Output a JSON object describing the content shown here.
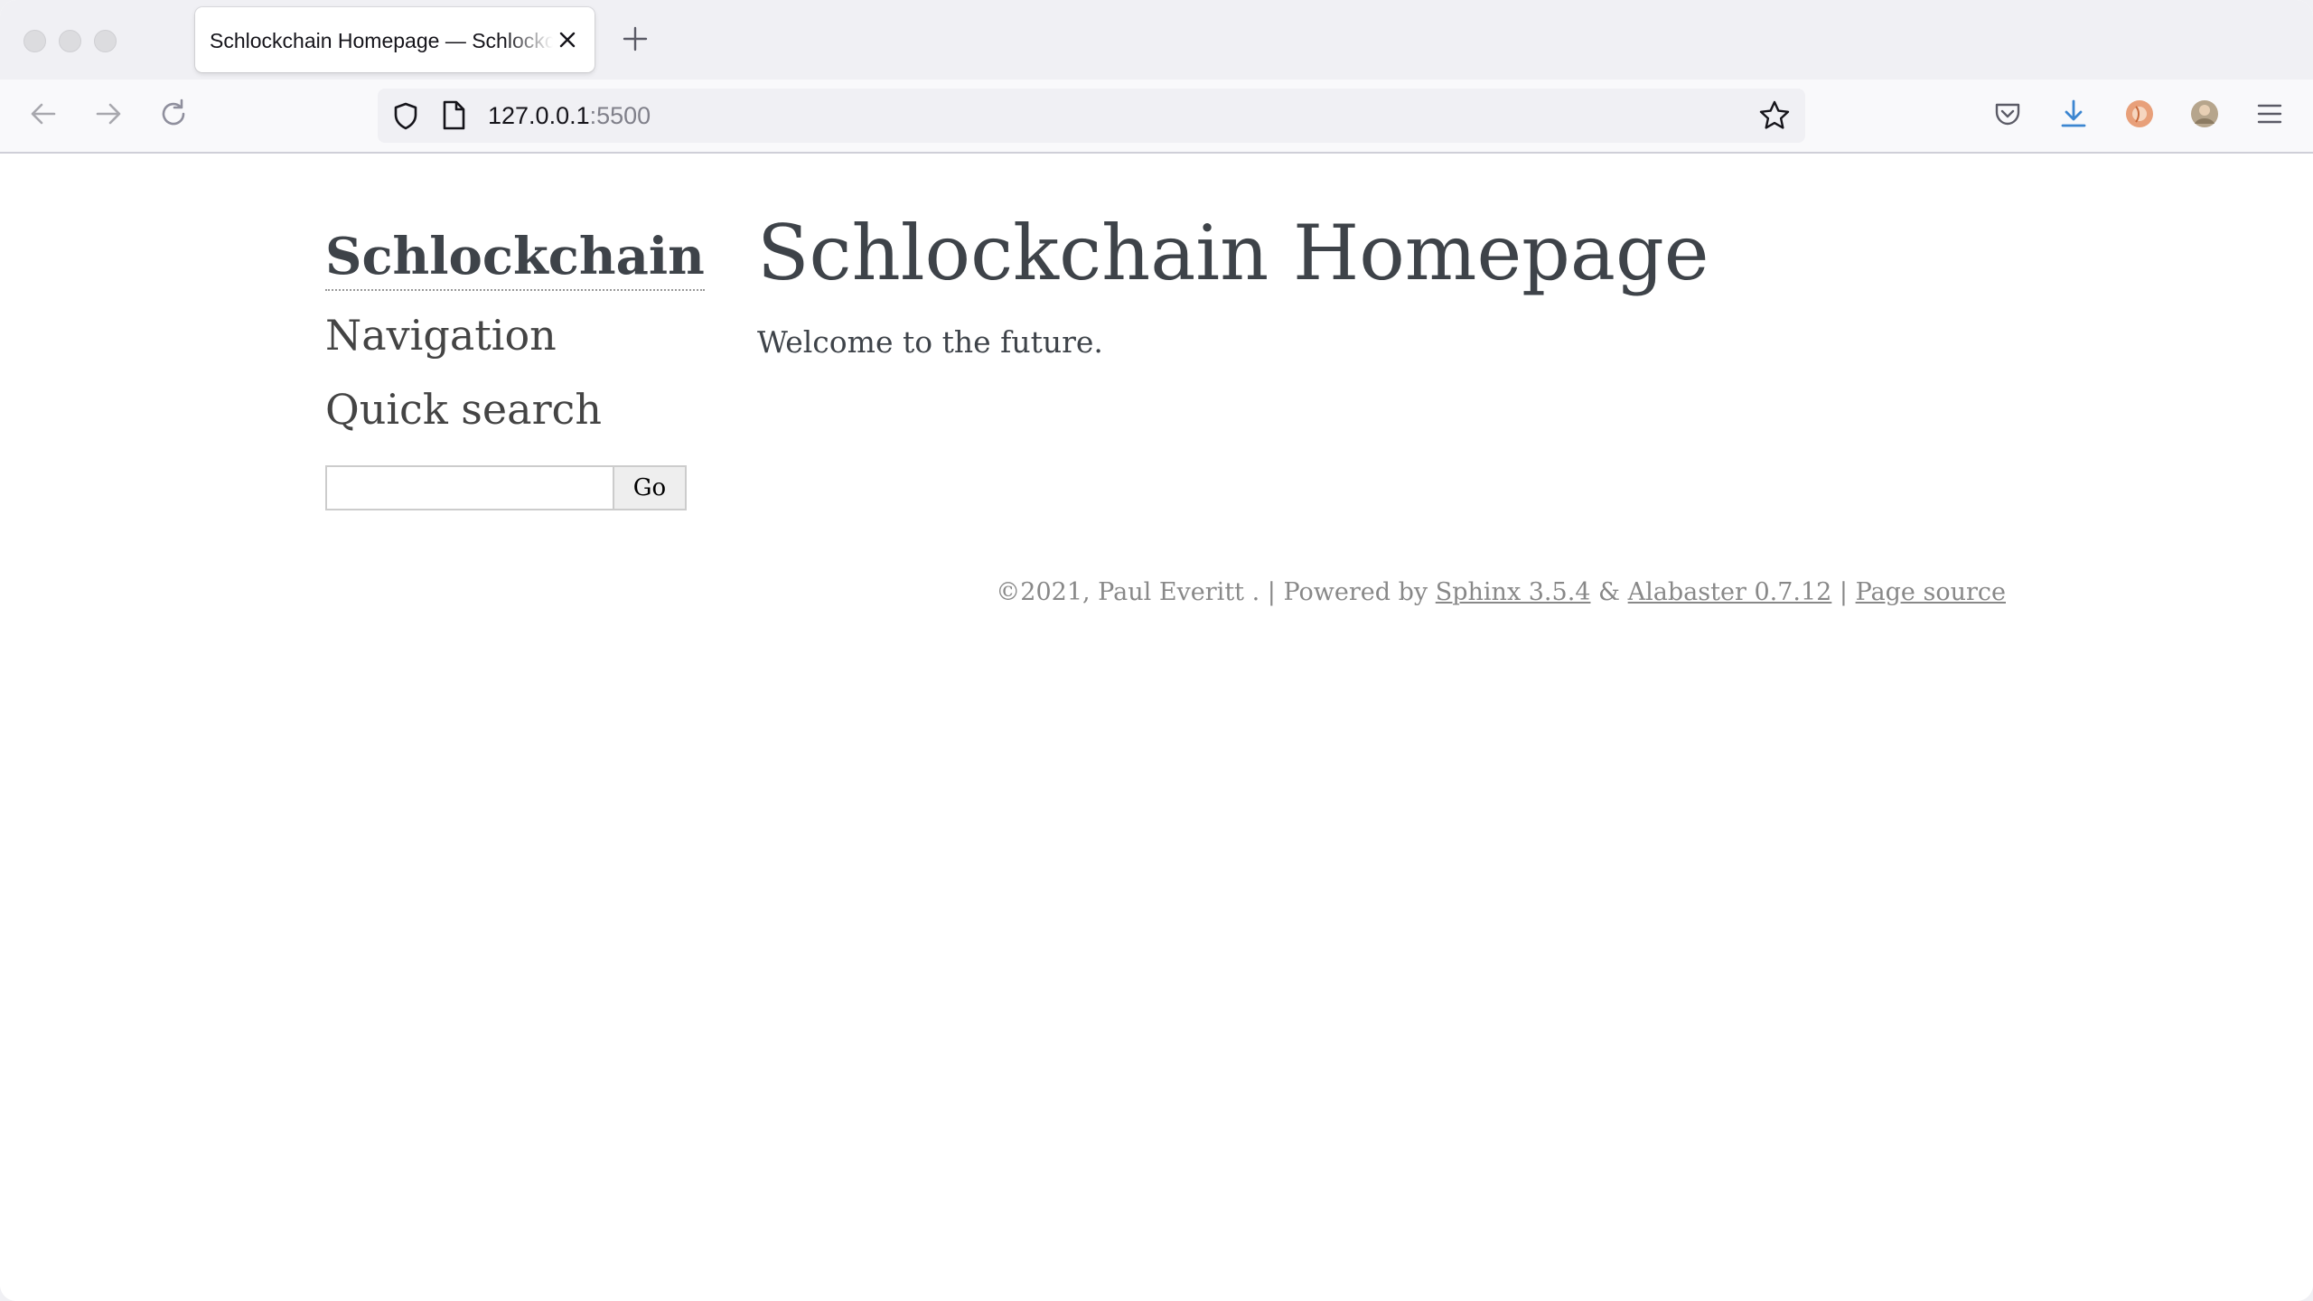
{
  "browser": {
    "tab_title": "Schlockchain Homepage — Schlockchain",
    "url_host": "127.0.0.1",
    "url_port": ":5500"
  },
  "sidebar": {
    "logo_text": "Schlockchain",
    "navigation_heading": "Navigation",
    "quick_search_heading": "Quick search",
    "search_value": "",
    "go_label": "Go"
  },
  "main": {
    "title": "Schlockchain Homepage",
    "welcome": "Welcome to the future."
  },
  "footer": {
    "copyright": "©2021, Paul Everitt .",
    "sep1": " | ",
    "powered_by": "Powered by ",
    "sphinx_link": "Sphinx 3.5.4",
    "amp": " & ",
    "alabaster_link": "Alabaster 0.7.12",
    "sep2": " | ",
    "page_source_link": "Page source"
  },
  "colors": {
    "text": "#3e4349",
    "footer_text": "#888888",
    "download_icon": "#3c86d1"
  }
}
